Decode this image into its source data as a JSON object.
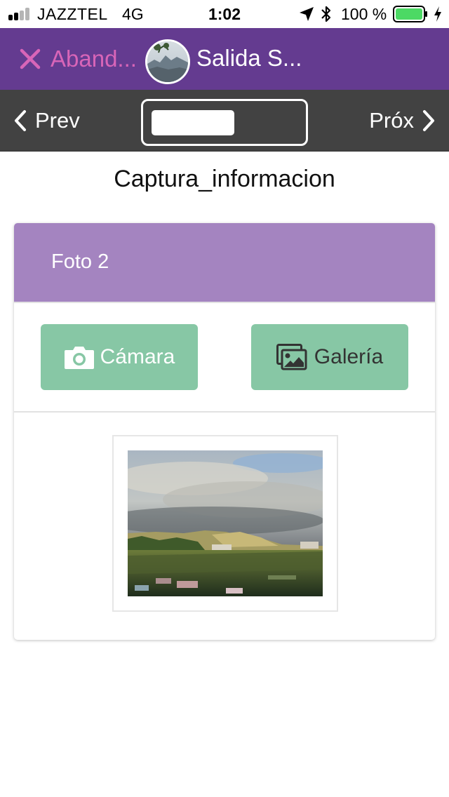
{
  "status_bar": {
    "carrier": "JAZZTEL",
    "network": "4G",
    "time": "1:02",
    "battery_percent": "100 %",
    "signal_bars_filled": 2,
    "signal_bars_total": 4,
    "battery_level": 1.0,
    "icons": [
      "signal-icon",
      "location-icon",
      "bluetooth-icon",
      "battery-icon",
      "charging-icon"
    ]
  },
  "header": {
    "abandon_label": "Aband...",
    "title": "Salida S...",
    "avatar_icon": "avatar",
    "close_icon": "close-icon",
    "background": "#643b90",
    "accent": "#d865b8"
  },
  "nav": {
    "prev_label": "Prev",
    "next_label": "Próx",
    "prev_icon": "chevron-left-icon",
    "next_icon": "chevron-right-icon",
    "background": "#424242"
  },
  "page": {
    "title": "Captura_informacion"
  },
  "card": {
    "title": "Foto 2",
    "header_color": "#a484c0",
    "camera_label": "Cámara",
    "gallery_label": "Galería",
    "button_color": "#87c7a5",
    "camera_icon": "camera-icon",
    "gallery_icon": "images-icon"
  }
}
